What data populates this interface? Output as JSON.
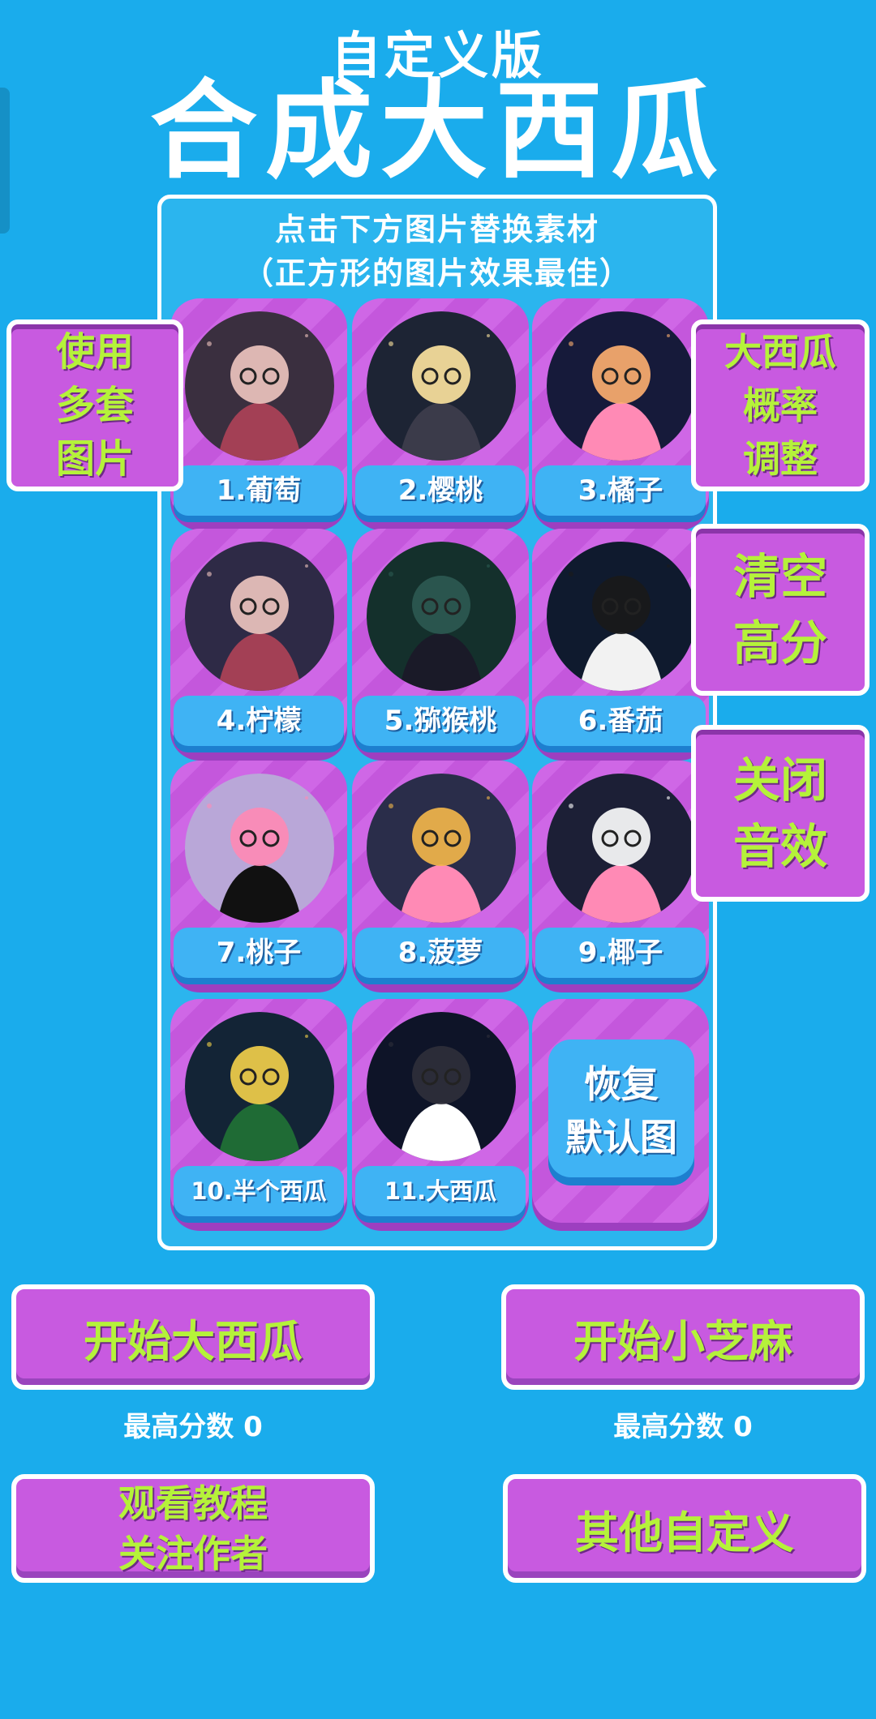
{
  "header": {
    "subtitle": "自定义版",
    "title": "合成大西瓜"
  },
  "panel": {
    "line1": "点击下方图片替换素材",
    "line2": "（正方形的图片效果最佳）"
  },
  "cards": [
    {
      "label": "1.葡萄",
      "palette": [
        "#3a2f3f",
        "#a34055",
        "#f0c6c0"
      ]
    },
    {
      "label": "2.樱桃",
      "palette": [
        "#1d2434",
        "#3b3b4a",
        "#ffe6a0"
      ]
    },
    {
      "label": "3.橘子",
      "palette": [
        "#161a3a",
        "#ff8ab5",
        "#ffb070"
      ]
    },
    {
      "label": "4.柠檬",
      "palette": [
        "#2e2a46",
        "#a34055",
        "#f0c6c0"
      ]
    },
    {
      "label": "5.猕猴桃",
      "palette": [
        "#14302c",
        "#1a1a28",
        "#2c5a52"
      ]
    },
    {
      "label": "6.番茄",
      "palette": [
        "#0f1a2e",
        "#f2f2f2",
        "#1a1a1a"
      ]
    },
    {
      "label": "7.桃子",
      "palette": [
        "#b9a7d8",
        "#111111",
        "#ff8ab5"
      ]
    },
    {
      "label": "8.菠萝",
      "palette": [
        "#2a2d4a",
        "#ff8ab5",
        "#f5b84a"
      ]
    },
    {
      "label": "9.椰子",
      "palette": [
        "#1c1f36",
        "#ff8ab5",
        "#ffffff"
      ]
    },
    {
      "label": "10.半个西瓜",
      "palette": [
        "#132436",
        "#1f6b35",
        "#f5d24a"
      ]
    },
    {
      "label": "11.大西瓜",
      "palette": [
        "#0e1428",
        "#ffffff",
        "#2f2f3a"
      ]
    }
  ],
  "restore_button": {
    "line1": "恢复",
    "line2": "默认图"
  },
  "side_buttons": {
    "multi": [
      "使用",
      "多套",
      "图片"
    ],
    "probability": [
      "大西瓜",
      "概率",
      "调整"
    ],
    "clear": [
      "清空",
      "高分"
    ],
    "sound": [
      "关闭",
      "音效"
    ]
  },
  "bottom": {
    "start_big": "开始大西瓜",
    "start_small": "开始小芝麻",
    "high_score_left": "最高分数  0",
    "high_score_right": "最高分数  0",
    "tutorial": [
      "观看教程",
      "关注作者"
    ],
    "other": "其他自定义"
  },
  "colors": {
    "background": "#1aacec",
    "card": "#c85ae0",
    "caption": "#3fb3f4",
    "button_text": "#b5f23a"
  }
}
